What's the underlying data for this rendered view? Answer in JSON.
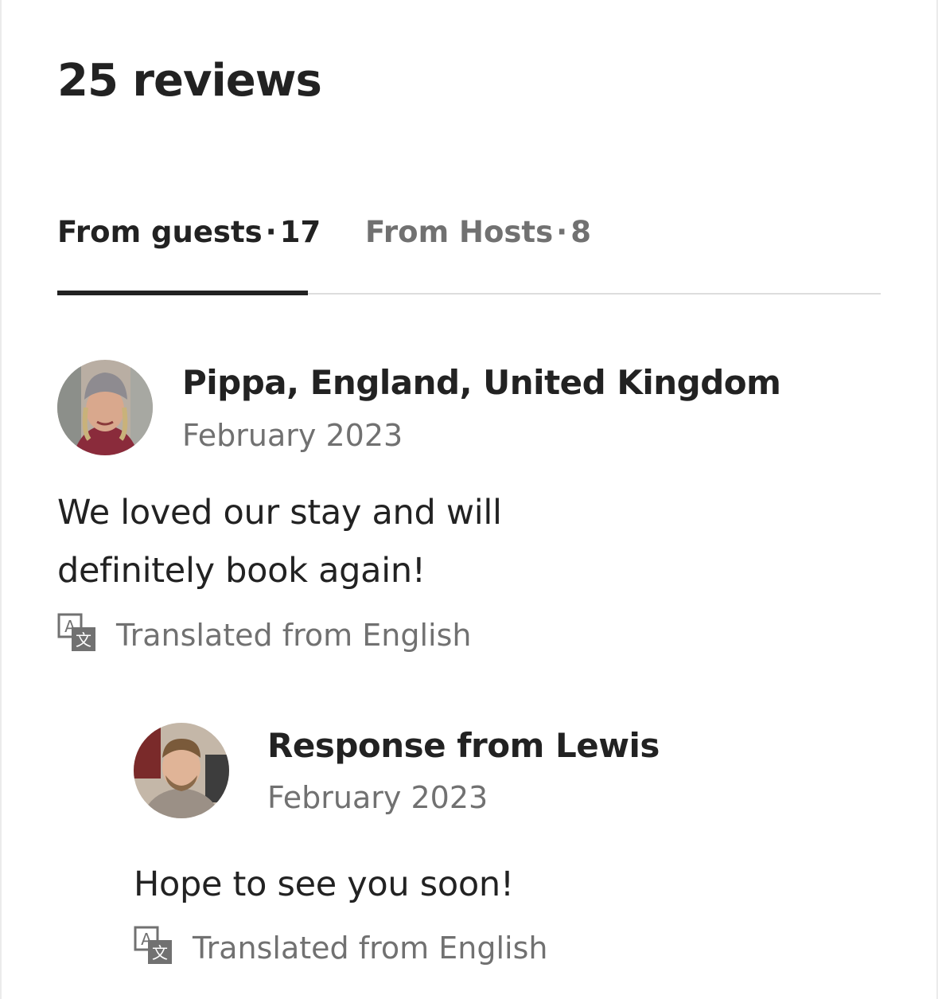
{
  "header": {
    "title": "25 reviews"
  },
  "tabs": [
    {
      "label": "From guests",
      "separator": "·",
      "count": "17",
      "active": true
    },
    {
      "label": "From Hosts",
      "separator": "·",
      "count": "8",
      "active": false
    }
  ],
  "review": {
    "author": "Pippa, England, United Kingdom",
    "date": "February 2023",
    "text_line1": "We loved our stay and will",
    "text_line2": "definitely book again!",
    "translated_note": "Translated from English",
    "avatar_icon": "user-photo-avatar"
  },
  "response": {
    "title": "Response from Lewis",
    "date": "February 2023",
    "text": "Hope to see you soon!",
    "translated_note": "Translated from English",
    "avatar_icon": "host-photo-avatar"
  },
  "icons": {
    "translate": "translate-icon"
  },
  "colors": {
    "primary_text": "#222222",
    "secondary_text": "#717171",
    "divider": "#dddddd"
  }
}
